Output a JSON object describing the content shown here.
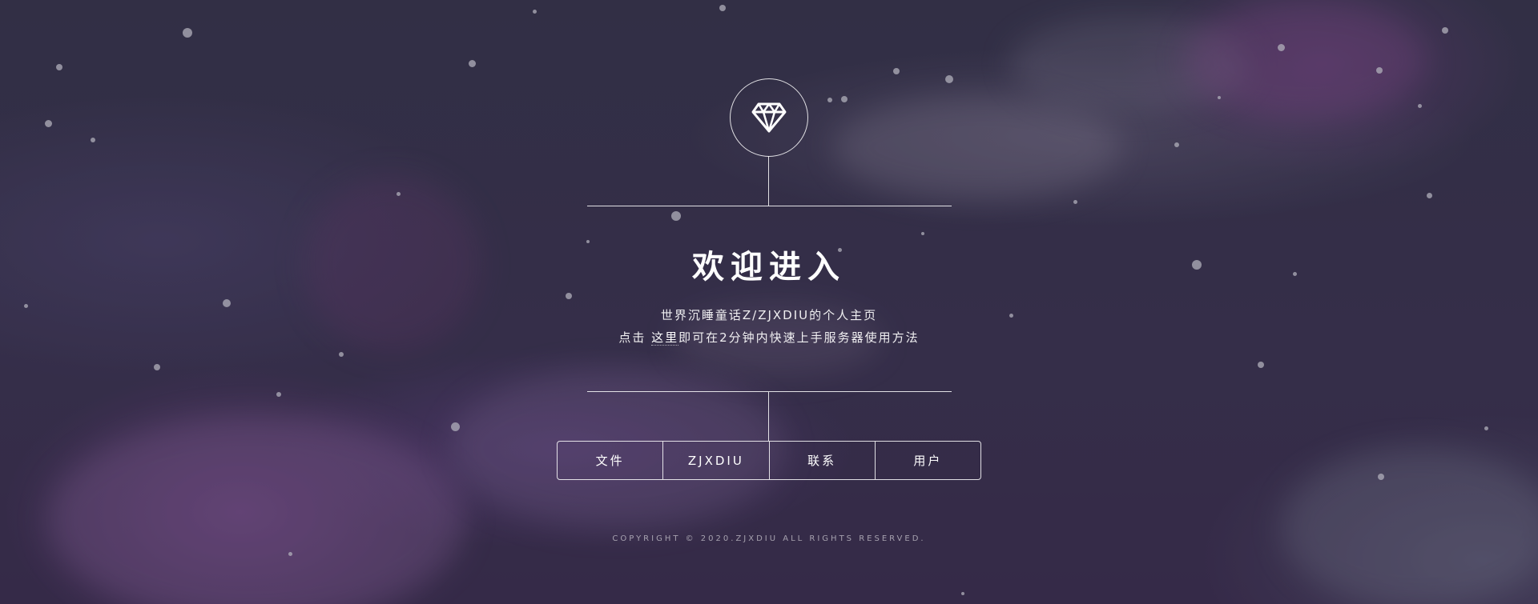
{
  "header": {
    "icon": "diamond-icon",
    "title": "欢迎进入",
    "subtitle_line1": "世界沉睡童话Z/ZJXDIU的个人主页",
    "subtitle_line2_prefix": "点击 ",
    "subtitle_line2_link": "这里",
    "subtitle_line2_suffix": "即可在2分钟内快速上手服务器使用方法"
  },
  "nav": {
    "items": [
      {
        "label": "文件"
      },
      {
        "label": "ZJXDIU"
      },
      {
        "label": "联系"
      },
      {
        "label": "用户"
      }
    ]
  },
  "footer": {
    "copyright": "COPYRIGHT © 2020.ZJXDIU ALL RIGHTS RESERVED."
  },
  "colors": {
    "background": "#35324a",
    "accent_purple": "#7a4a8c",
    "line": "#ffffff"
  }
}
